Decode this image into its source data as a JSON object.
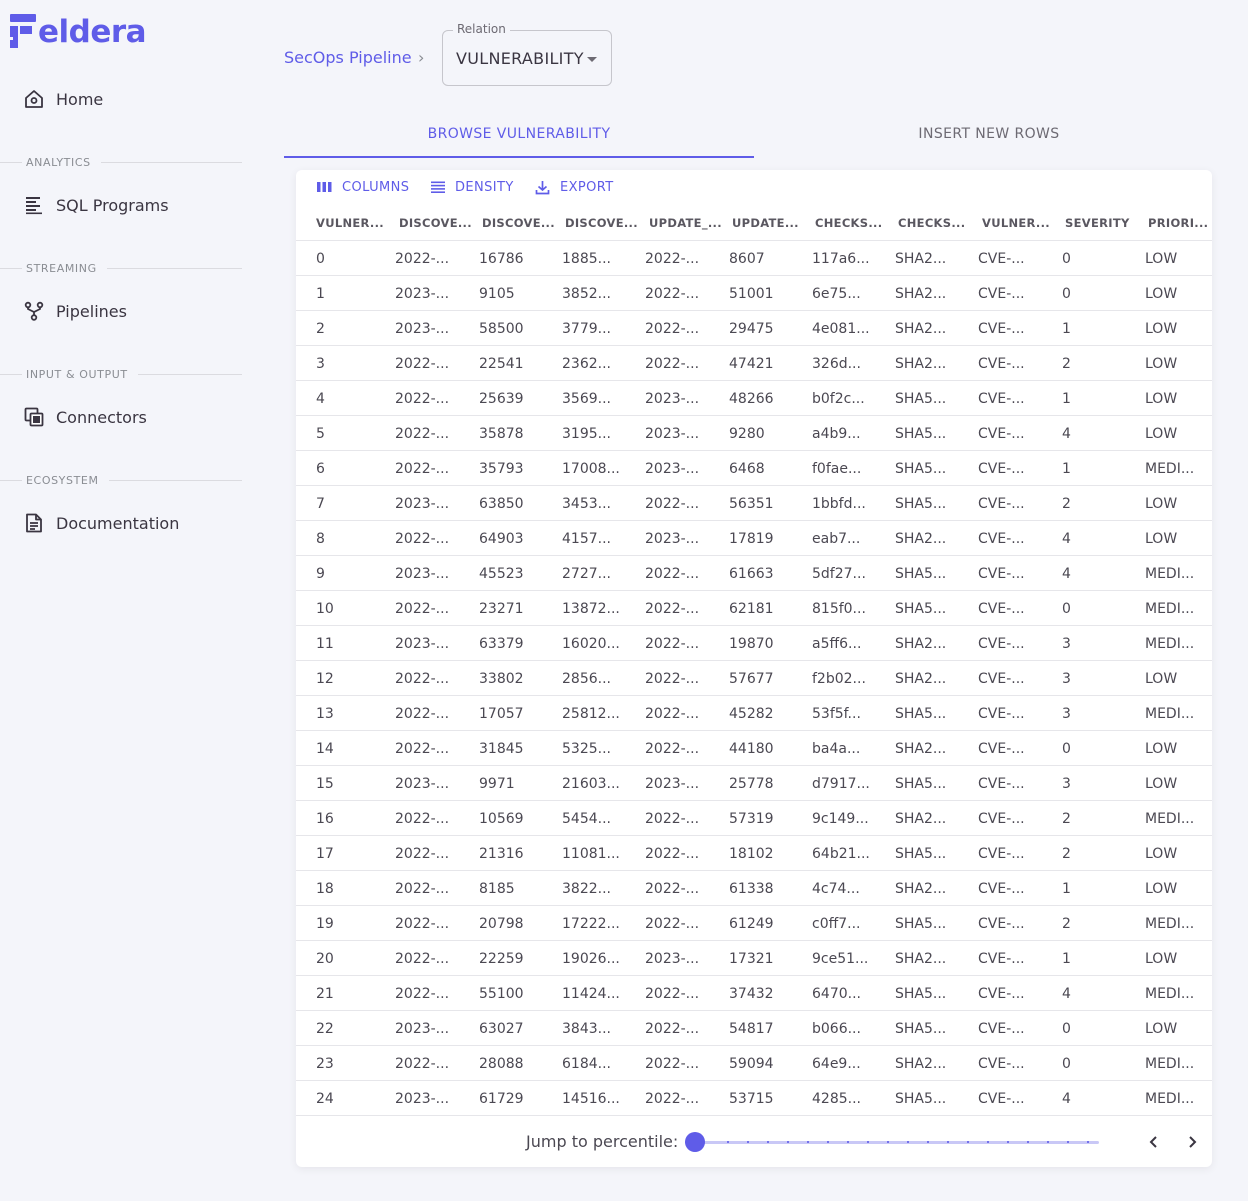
{
  "app": {
    "logo_text": "eldera"
  },
  "sidebar": {
    "items": [
      {
        "label": "Home",
        "icon": "home-icon"
      },
      {
        "label": "SQL Programs",
        "icon": "document-lines-icon"
      },
      {
        "label": "Pipelines",
        "icon": "branch-icon"
      },
      {
        "label": "Connectors",
        "icon": "stacked-squares-icon"
      },
      {
        "label": "Documentation",
        "icon": "file-text-icon"
      }
    ],
    "sections": [
      "ANALYTICS",
      "STREAMING",
      "INPUT & OUTPUT",
      "ECOSYSTEM"
    ]
  },
  "breadcrumb": {
    "pipeline": "SecOps Pipeline",
    "separator": "›"
  },
  "relation": {
    "label": "Relation",
    "value": "VULNERABILITY"
  },
  "tabs": [
    {
      "label": "BROWSE VULNERABILITY",
      "active": true
    },
    {
      "label": "INSERT NEW ROWS",
      "active": false
    }
  ],
  "toolbar": {
    "columns": "COLUMNS",
    "density": "DENSITY",
    "export": "EXPORT"
  },
  "grid": {
    "columns": [
      "VULNER...",
      "DISCOVE...",
      "DISCOVE...",
      "DISCOVE...",
      "UPDATE_...",
      "UPDATE...",
      "CHECKS...",
      "CHECKS...",
      "VULNER...",
      "SEVERITY",
      "PRIORI..."
    ],
    "rows": [
      [
        "0",
        "2022-...",
        "16786",
        "1885...",
        "2022-...",
        "8607",
        "117a6...",
        "SHA2...",
        "CVE-...",
        "0",
        "LOW"
      ],
      [
        "1",
        "2023-...",
        "9105",
        "3852...",
        "2022-...",
        "51001",
        "6e75...",
        "SHA2...",
        "CVE-...",
        "0",
        "LOW"
      ],
      [
        "2",
        "2023-...",
        "58500",
        "3779...",
        "2022-...",
        "29475",
        "4e081...",
        "SHA2...",
        "CVE-...",
        "1",
        "LOW"
      ],
      [
        "3",
        "2022-...",
        "22541",
        "2362...",
        "2022-...",
        "47421",
        "326d...",
        "SHA2...",
        "CVE-...",
        "2",
        "LOW"
      ],
      [
        "4",
        "2022-...",
        "25639",
        "3569...",
        "2023-...",
        "48266",
        "b0f2c...",
        "SHA5...",
        "CVE-...",
        "1",
        "LOW"
      ],
      [
        "5",
        "2022-...",
        "35878",
        "3195...",
        "2023-...",
        "9280",
        "a4b9...",
        "SHA5...",
        "CVE-...",
        "4",
        "LOW"
      ],
      [
        "6",
        "2022-...",
        "35793",
        "17008...",
        "2023-...",
        "6468",
        "f0fae...",
        "SHA5...",
        "CVE-...",
        "1",
        "MEDI..."
      ],
      [
        "7",
        "2023-...",
        "63850",
        "3453...",
        "2022-...",
        "56351",
        "1bbfd...",
        "SHA5...",
        "CVE-...",
        "2",
        "LOW"
      ],
      [
        "8",
        "2022-...",
        "64903",
        "4157...",
        "2023-...",
        "17819",
        "eab7...",
        "SHA2...",
        "CVE-...",
        "4",
        "LOW"
      ],
      [
        "9",
        "2023-...",
        "45523",
        "2727...",
        "2022-...",
        "61663",
        "5df27...",
        "SHA5...",
        "CVE-...",
        "4",
        "MEDI..."
      ],
      [
        "10",
        "2022-...",
        "23271",
        "13872...",
        "2022-...",
        "62181",
        "815f0...",
        "SHA5...",
        "CVE-...",
        "0",
        "MEDI..."
      ],
      [
        "11",
        "2023-...",
        "63379",
        "16020...",
        "2022-...",
        "19870",
        "a5ff6...",
        "SHA2...",
        "CVE-...",
        "3",
        "MEDI..."
      ],
      [
        "12",
        "2022-...",
        "33802",
        "2856...",
        "2022-...",
        "57677",
        "f2b02...",
        "SHA2...",
        "CVE-...",
        "3",
        "LOW"
      ],
      [
        "13",
        "2022-...",
        "17057",
        "25812...",
        "2022-...",
        "45282",
        "53f5f...",
        "SHA5...",
        "CVE-...",
        "3",
        "MEDI..."
      ],
      [
        "14",
        "2022-...",
        "31845",
        "5325...",
        "2022-...",
        "44180",
        "ba4a...",
        "SHA2...",
        "CVE-...",
        "0",
        "LOW"
      ],
      [
        "15",
        "2023-...",
        "9971",
        "21603...",
        "2023-...",
        "25778",
        "d7917...",
        "SHA5...",
        "CVE-...",
        "3",
        "LOW"
      ],
      [
        "16",
        "2022-...",
        "10569",
        "5454...",
        "2022-...",
        "57319",
        "9c149...",
        "SHA2...",
        "CVE-...",
        "2",
        "MEDI..."
      ],
      [
        "17",
        "2022-...",
        "21316",
        "11081...",
        "2022-...",
        "18102",
        "64b21...",
        "SHA5...",
        "CVE-...",
        "2",
        "LOW"
      ],
      [
        "18",
        "2022-...",
        "8185",
        "3822...",
        "2022-...",
        "61338",
        "4c74...",
        "SHA2...",
        "CVE-...",
        "1",
        "LOW"
      ],
      [
        "19",
        "2022-...",
        "20798",
        "17222...",
        "2022-...",
        "61249",
        "c0ff7...",
        "SHA5...",
        "CVE-...",
        "2",
        "MEDI..."
      ],
      [
        "20",
        "2022-...",
        "22259",
        "19026...",
        "2023-...",
        "17321",
        "9ce51...",
        "SHA2...",
        "CVE-...",
        "1",
        "LOW"
      ],
      [
        "21",
        "2022-...",
        "55100",
        "11424...",
        "2022-...",
        "37432",
        "6470...",
        "SHA5...",
        "CVE-...",
        "4",
        "MEDI..."
      ],
      [
        "22",
        "2023-...",
        "63027",
        "3843...",
        "2022-...",
        "54817",
        "b066...",
        "SHA5...",
        "CVE-...",
        "0",
        "LOW"
      ],
      [
        "23",
        "2022-...",
        "28088",
        "6184...",
        "2022-...",
        "59094",
        "64e9...",
        "SHA2...",
        "CVE-...",
        "0",
        "MEDI..."
      ],
      [
        "24",
        "2023-...",
        "61729",
        "14516...",
        "2022-...",
        "53715",
        "4285...",
        "SHA5...",
        "CVE-...",
        "4",
        "MEDI..."
      ]
    ]
  },
  "footer": {
    "jump_label": "Jump to percentile:",
    "percentile": 0
  },
  "colors": {
    "accent": "#5f5ce8",
    "background": "#f4f5fa",
    "text": "#3a3541",
    "muted": "#8a8d93"
  }
}
